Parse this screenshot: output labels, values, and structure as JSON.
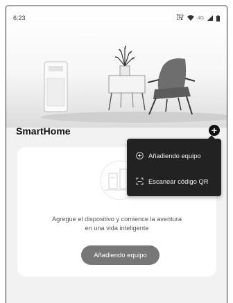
{
  "status_bar": {
    "time": "6:23",
    "volte_line1": "Yo'o",
    "volte_line2": "LTE",
    "signal_label": "4G"
  },
  "app": {
    "title": "SmartHome"
  },
  "add_menu": {
    "items": [
      {
        "label": "Añadiendo equipo",
        "icon": "add-circle-icon"
      },
      {
        "label": "Escanear código QR",
        "icon": "scan-icon"
      }
    ]
  },
  "empty_state": {
    "message_line1": "Agregue el dispositivo y comience la aventura",
    "message_line2": "en una vida inteligente",
    "button_label": "Añadiendo equipo"
  },
  "colors": {
    "menu_background": "#222222",
    "button_background": "#777777",
    "page_background": "#f2f2f2"
  }
}
